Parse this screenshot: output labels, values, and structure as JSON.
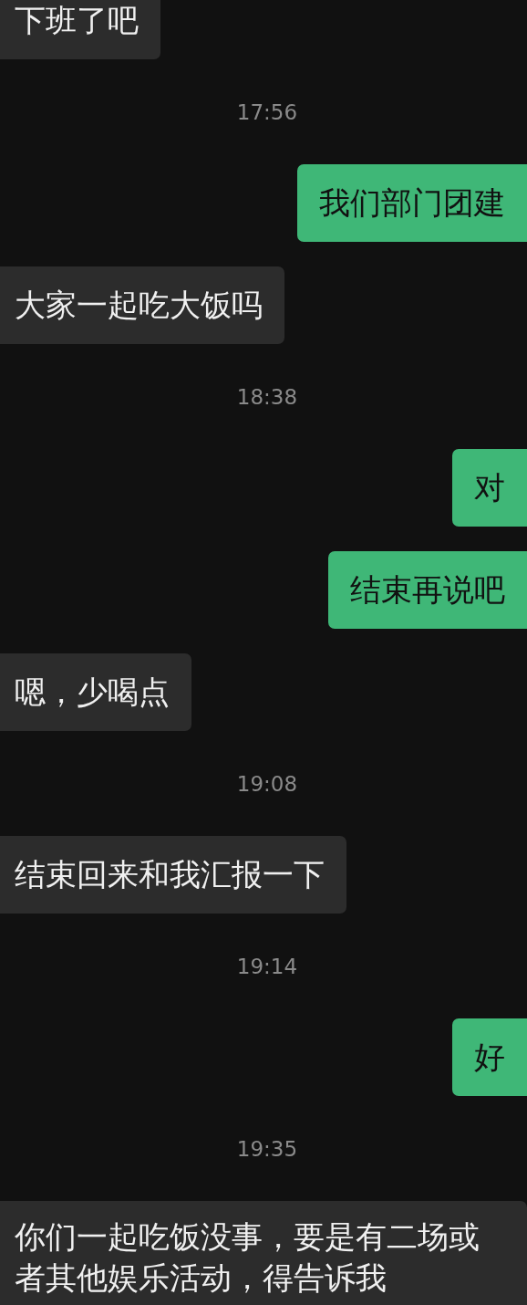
{
  "messages": [
    {
      "kind": "message",
      "outgoing": false,
      "text": "下班了吧"
    },
    {
      "kind": "time",
      "text": "17:56"
    },
    {
      "kind": "message",
      "outgoing": true,
      "text": "我们部门团建"
    },
    {
      "kind": "message",
      "outgoing": false,
      "text": "大家一起吃大饭吗"
    },
    {
      "kind": "time",
      "text": "18:38"
    },
    {
      "kind": "message",
      "outgoing": true,
      "text": "对"
    },
    {
      "kind": "message",
      "outgoing": true,
      "text": "结束再说吧"
    },
    {
      "kind": "message",
      "outgoing": false,
      "text": "嗯，少喝点"
    },
    {
      "kind": "time",
      "text": "19:08"
    },
    {
      "kind": "message",
      "outgoing": false,
      "text": "结束回来和我汇报一下"
    },
    {
      "kind": "time",
      "text": "19:14"
    },
    {
      "kind": "message",
      "outgoing": true,
      "text": "好"
    },
    {
      "kind": "time",
      "text": "19:35"
    },
    {
      "kind": "message",
      "outgoing": false,
      "text": "你们一起吃饭没事，要是有二场或者其他娱乐活动，得告诉我"
    }
  ]
}
